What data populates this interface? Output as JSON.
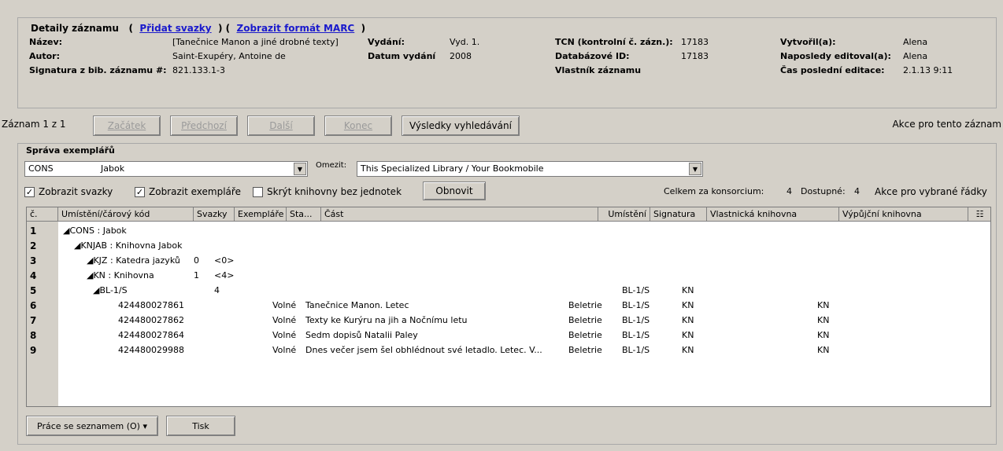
{
  "details": {
    "title": "Detaily záznamu",
    "add_volumes": "Přidat svazky",
    "show_marc": "Zobrazit formát MARC",
    "labels": {
      "nazev": "Název:",
      "autor": "Autor:",
      "signatura": "Signatura z bib. záznamu #:",
      "vydani": "Vydání:",
      "datum": "Datum vydání",
      "tcn": "TCN (kontrolní č. zázn.):",
      "db_id": "Databázové ID:",
      "vlastnik": "Vlastník záznamu",
      "vytvoril": "Vytvořil(a):",
      "naposledy": "Naposledy editoval(a):",
      "cas": "Čas poslední editace:"
    },
    "values": {
      "nazev": "[Tanečnice Manon a jiné drobné texty]",
      "autor": "Saint-Exupéry, Antoine de",
      "signatura": "821.133.1-3",
      "vydani": "Vyd. 1.",
      "datum": "2008",
      "tcn": "17183",
      "db_id": "17183",
      "vytvoril": "Alena",
      "naposledy": "Alena",
      "cas": "2.1.13 9:11"
    }
  },
  "nav": {
    "record_count": "Záznam 1 z 1",
    "start": "Začátek",
    "prev": "Předchozí",
    "next": "Další",
    "end": "Konec",
    "results": "Výsledky vyhledávání",
    "record_actions": "Akce pro tento záznam"
  },
  "items": {
    "title": "Správa exemplářů",
    "org_code": "CONS",
    "org_name": "Jabok",
    "limit_label": "Omezit:",
    "limit_value": "This Specialized Library / Your Bookmobile",
    "cb_volumes": "Zobrazit svazky",
    "cb_copies": "Zobrazit exempláře",
    "cb_hide": "Skrýt knihovny bez jednotek",
    "refresh": "Obnovit",
    "total_label": "Celkem za konsorcium:",
    "total_value": "4",
    "available_label": "Dostupné:",
    "available_value": "4",
    "selected_actions": "Akce pro vybrané řádky"
  },
  "grid": {
    "headers": [
      "č.",
      "Umístění/čárový kód",
      "Svazky",
      "Exempláře",
      "Sta...",
      "Část",
      "Umístění",
      "Signatura",
      "Vlastnická knihovna",
      "Výpůjční knihovna"
    ],
    "rows": [
      {
        "n": "1",
        "tree": "◢CONS : Jabok",
        "svazky": "",
        "exemplare": "",
        "status": "",
        "cast": "",
        "umisteni": "",
        "signatura": "",
        "vlastnicka": "",
        "vypujcni": ""
      },
      {
        "n": "2",
        "tree": "◢KNJAB : Knihovna Jabok",
        "svazky": "",
        "exemplare": "",
        "status": "",
        "cast": "",
        "umisteni": "",
        "signatura": "",
        "vlastnicka": "",
        "vypujcni": ""
      },
      {
        "n": "3",
        "tree": "◢KJZ : Katedra jazyků",
        "svazky": "0",
        "exemplare": "<0>",
        "status": "",
        "cast": "",
        "umisteni": "",
        "signatura": "",
        "vlastnicka": "",
        "vypujcni": ""
      },
      {
        "n": "4",
        "tree": "◢KN : Knihovna",
        "svazky": "1",
        "exemplare": "<4>",
        "status": "",
        "cast": "",
        "umisteni": "",
        "signatura": "",
        "vlastnicka": "",
        "vypujcni": ""
      },
      {
        "n": "5",
        "tree": "◢BL-1/S",
        "svazky": "",
        "exemplare": "4",
        "status": "",
        "cast": "",
        "umisteni": "",
        "signatura": "BL-1/S",
        "vlastnicka": "KN",
        "vypujcni": ""
      },
      {
        "n": "6",
        "tree": "424480027861",
        "svazky": "",
        "exemplare": "",
        "status": "Volné",
        "cast": "Tanečnice Manon. Letec",
        "umisteni": "Beletrie",
        "signatura": "BL-1/S",
        "vlastnicka": "KN",
        "vypujcni": "KN"
      },
      {
        "n": "7",
        "tree": "424480027862",
        "svazky": "",
        "exemplare": "",
        "status": "Volné",
        "cast": "Texty ke Kurýru na jih a Nočnímu letu",
        "umisteni": "Beletrie",
        "signatura": "BL-1/S",
        "vlastnicka": "KN",
        "vypujcni": "KN"
      },
      {
        "n": "8",
        "tree": "424480027864",
        "svazky": "",
        "exemplare": "",
        "status": "Volné",
        "cast": "Sedm dopisů Natalii Paley",
        "umisteni": "Beletrie",
        "signatura": "BL-1/S",
        "vlastnicka": "KN",
        "vypujcni": "KN"
      },
      {
        "n": "9",
        "tree": "424480029988",
        "svazky": "",
        "exemplare": "",
        "status": "Volné",
        "cast": "Dnes večer jsem šel obhlédnout své letadlo. Letec. V...",
        "umisteni": "Beletrie",
        "signatura": "BL-1/S",
        "vlastnicka": "KN",
        "vypujcni": "KN"
      }
    ]
  },
  "bottom": {
    "list_work": "Práce se seznamem (O)",
    "print": "Tisk"
  }
}
